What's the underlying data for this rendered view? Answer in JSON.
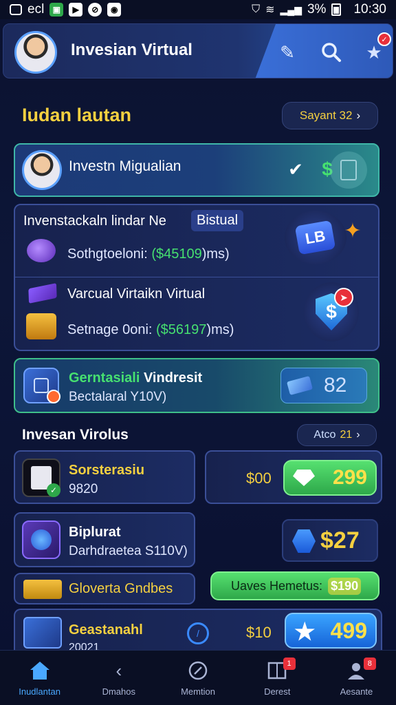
{
  "status": {
    "battery": "3%",
    "time": "10:30",
    "left_text": "ecl"
  },
  "header": {
    "title": "Invesian Virtual"
  },
  "section1": {
    "title": "Iudan lautan",
    "button_label": "Sayant 32"
  },
  "card_migualian": {
    "title": "Investn Migualian"
  },
  "card_group": {
    "title_main": "Invenstackaln lindar Ne",
    "title_tag": "Bistual",
    "row1_label": "Sothgtoeloni:",
    "row1_value": "($45109",
    "row1_suffix": ")ms)",
    "badge_lb": "LB",
    "row2_title": "Varcual Virtaikn Virtual",
    "row2_label": "Setnage 0oni:",
    "row2_value": "($56197",
    "row2_suffix": ")ms)"
  },
  "card_green": {
    "title_green": "Gerntasiali",
    "title_white": "Vindresit",
    "subtitle": "Bectalaral Y10V)",
    "value": "82"
  },
  "section2": {
    "title": "Invesan Virolus",
    "button_label": "Atco",
    "button_value": "21"
  },
  "items": [
    {
      "title": "Sorsterasiu",
      "subtitle": "9820",
      "amount": "$00",
      "button_value": "299"
    },
    {
      "title": "Biplurat",
      "subtitle": "Darhdraetea S110V)",
      "amount": "",
      "button_value": "$27"
    },
    {
      "title": "Gloverta Gndbes",
      "subtitle": "",
      "amount": "",
      "button_label": "Uaves Hemetus:",
      "button_value": "$190"
    },
    {
      "title": "Geastanahl",
      "subtitle": "20021",
      "amount": "$10",
      "button_value": "499"
    }
  ],
  "nav": [
    {
      "label": "Inudlantan",
      "icon": "home-icon"
    },
    {
      "label": "Dmahos",
      "icon": "back-icon"
    },
    {
      "label": "Memtion",
      "icon": "compass-icon"
    },
    {
      "label": "Derest",
      "icon": "book-icon",
      "badge": "1"
    },
    {
      "label": "Aesante",
      "icon": "user-icon",
      "badge": "8"
    }
  ],
  "colors": {
    "accent_yellow": "#f5d040",
    "accent_green": "#46e070",
    "accent_blue": "#3aa4ff",
    "badge_red": "#e8303a"
  }
}
